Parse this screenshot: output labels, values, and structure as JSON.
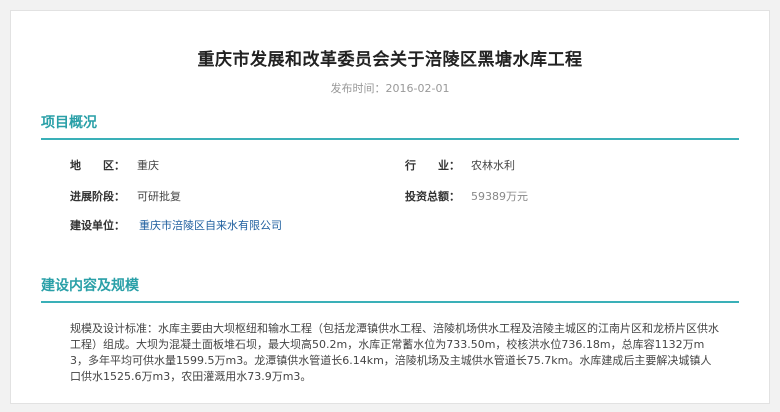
{
  "article": {
    "title": "重庆市发展和改革委员会关于涪陵区黑塘水库工程",
    "publish_date": "发布时间：2016-02-01"
  },
  "overview": {
    "heading": "项目概况",
    "region_label": "地　　区：",
    "region_value": "重庆",
    "industry_label": "行　　业：",
    "industry_value": "农林水利",
    "stage_label": "进展阶段：",
    "stage_value": "可研批复",
    "investment_label": "投资总额：",
    "investment_value": "59389万元",
    "builder_label": "建设单位：",
    "builder_value": "重庆市涪陵区自来水有限公司"
  },
  "scope": {
    "heading": "建设内容及规模",
    "description": "规模及设计标准：水库主要由大坝枢纽和输水工程（包括龙潭镇供水工程、涪陵机场供水工程及涪陵主城区的江南片区和龙桥片区供水工程）组成。大坝为混凝土面板堆石坝，最大坝高50.2m，水库正常蓄水位为733.50m，校核洪水位736.18m，总库容1132万m3，多年平均可供水量1599.5万m3。龙潭镇供水管道长6.14km，涪陵机场及主城供水管道长75.7km。水库建成后主要解决城镇人口供水1525.6万m3，农田灌溉用水73.9万m3。"
  },
  "colors": {
    "accent": "#2aa0a8",
    "rule": "#3ab0b8",
    "link": "#1f5f9f"
  }
}
